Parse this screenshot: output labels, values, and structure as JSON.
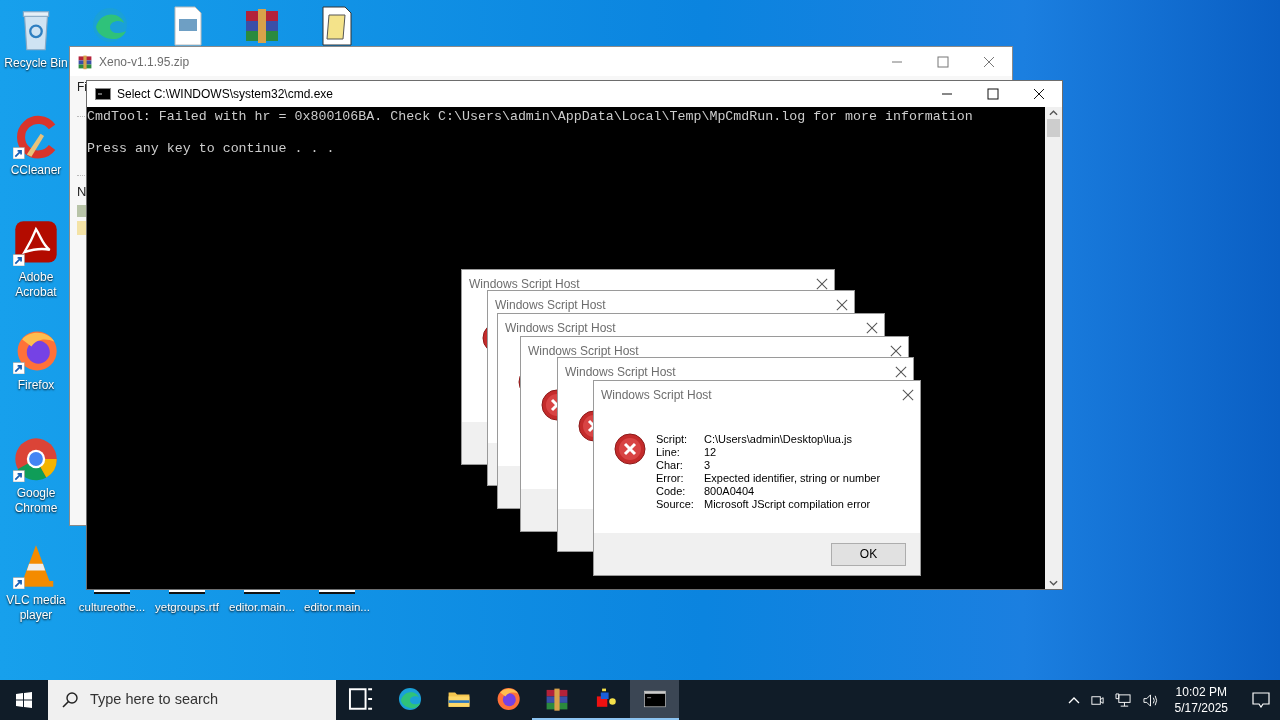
{
  "desktop_icons": [
    {
      "label": "Recycle Bin",
      "kind": "recycle-bin",
      "shortcut": false
    },
    {
      "label": "CCleaner",
      "kind": "ccleaner",
      "shortcut": true
    },
    {
      "label": "Adobe Acrobat",
      "kind": "acrobat",
      "shortcut": true
    },
    {
      "label": "Firefox",
      "kind": "firefox",
      "shortcut": true
    },
    {
      "label": "Google Chrome",
      "kind": "chrome",
      "shortcut": true
    },
    {
      "label": "VLC media player",
      "kind": "vlc",
      "shortcut": true
    }
  ],
  "top_row_icons": [
    {
      "kind": "edge"
    },
    {
      "kind": "image-file"
    },
    {
      "kind": "winrar"
    },
    {
      "kind": "script-file"
    }
  ],
  "desktop_files": [
    {
      "label": "cultureothe..."
    },
    {
      "label": "yetgroups.rtf"
    },
    {
      "label": "editor.main..."
    },
    {
      "label": "editor.main..."
    }
  ],
  "archive_window": {
    "title": "Xeno-v1.1.95.zip",
    "menu_fragment": "Fi",
    "header_fragment": "N"
  },
  "console_window": {
    "title": "Select C:\\WINDOWS\\system32\\cmd.exe",
    "lines": [
      "CmdTool: Failed with hr = 0x800106BA. Check C:\\Users\\admin\\AppData\\Local\\Temp\\MpCmdRun.log for more information",
      "Press any key to continue . . ."
    ]
  },
  "dialogs": [
    {
      "title": "Windows Script Host"
    },
    {
      "title": "Windows Script Host"
    },
    {
      "title": "Windows Script Host"
    },
    {
      "title": "Windows Script Host"
    },
    {
      "title": "Windows Script Host"
    },
    {
      "title": "Windows Script Host",
      "fields": [
        {
          "label": "Script:",
          "value": "C:\\Users\\admin\\Desktop\\lua.js"
        },
        {
          "label": "Line:",
          "value": "12"
        },
        {
          "label": "Char:",
          "value": "3"
        },
        {
          "label": "Error:",
          "value": "Expected identifier, string or number"
        },
        {
          "label": "Code:",
          "value": "800A0404"
        },
        {
          "label": "Source:",
          "value": "Microsoft JScript compilation error"
        }
      ],
      "button": "OK"
    }
  ],
  "taskbar": {
    "search_placeholder": "Type here to search",
    "apps": [
      {
        "kind": "task-view",
        "running": false,
        "selected": false
      },
      {
        "kind": "edge",
        "running": false,
        "selected": false
      },
      {
        "kind": "folder",
        "running": false,
        "selected": false
      },
      {
        "kind": "firefox",
        "running": false,
        "selected": false
      },
      {
        "kind": "winrar",
        "running": true,
        "selected": false
      },
      {
        "kind": "app",
        "running": true,
        "selected": false
      },
      {
        "kind": "console",
        "running": true,
        "selected": true
      }
    ],
    "time": "10:02 PM",
    "date": "5/17/2025"
  }
}
